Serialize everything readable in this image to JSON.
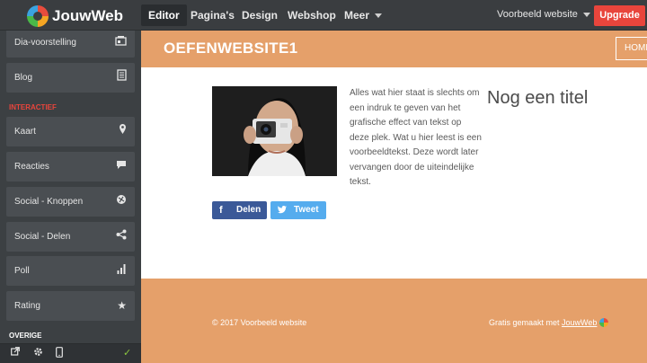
{
  "app": {
    "name": "JouwWeb",
    "logo_icon": "jouwweb-logo-icon"
  },
  "topnav": {
    "items": [
      {
        "label": "Editor",
        "active": true
      },
      {
        "label": "Pagina's"
      },
      {
        "label": "Design"
      },
      {
        "label": "Webshop"
      },
      {
        "label": "Meer"
      }
    ],
    "site_selector": "Voorbeeld website",
    "upgrade_label": "Upgrade"
  },
  "sidebar": {
    "items": [
      {
        "label": "Dia-voorstelling",
        "icon": "slideshow-icon"
      },
      {
        "label": "Blog",
        "icon": "blog-icon"
      }
    ],
    "section_interactief": "INTERACTIEF",
    "interactief_items": [
      {
        "label": "Kaart",
        "icon": "map-pin-icon"
      },
      {
        "label": "Reacties",
        "icon": "comment-icon"
      },
      {
        "label": "Social - Knoppen",
        "icon": "social-buttons-icon"
      },
      {
        "label": "Social - Delen",
        "icon": "share-icon"
      },
      {
        "label": "Poll",
        "icon": "bar-chart-icon"
      },
      {
        "label": "Rating",
        "icon": "star-icon"
      }
    ],
    "section_overige": "OVERIGE",
    "accent_color": "#e8453c"
  },
  "preview": {
    "site_title": "OEFENWEBSITE1",
    "nav_home": "HOME",
    "body_text": "Alles wat hier staat is slechts om een indruk te geven van het grafische effect van tekst op deze plek. Wat u hier leest is een voorbeeldtekst. Deze wordt later vervangen door de uiteindelijke tekst.",
    "heading": "Nog een titel",
    "share_facebook": "Delen",
    "share_twitter": "Tweet",
    "footer_copyright": "© 2017 Voorbeeld website",
    "footer_made_prefix": "Gratis gemaakt met",
    "footer_made_link": "JouwWeb",
    "brand_color": "#e5a06a"
  }
}
